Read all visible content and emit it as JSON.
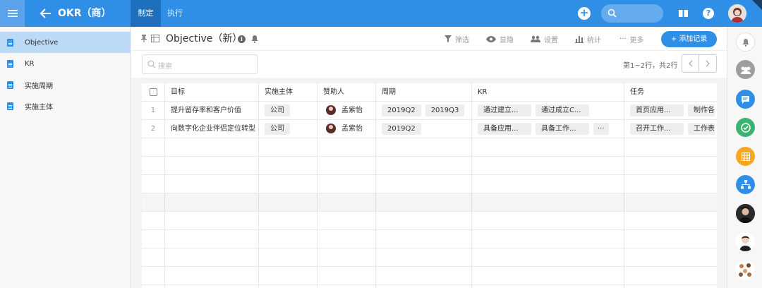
{
  "header": {
    "app_title": "OKR（商）",
    "tabs": [
      {
        "label": "制定"
      },
      {
        "label": "执行"
      }
    ]
  },
  "sidebar": {
    "items": [
      {
        "label": "Objective"
      },
      {
        "label": "KR"
      },
      {
        "label": "实施周期"
      },
      {
        "label": "实施主体"
      }
    ]
  },
  "toolbar": {
    "view_title": "Objective（新）",
    "filter": "筛选",
    "show_hide": "显隐",
    "settings": "设置",
    "stats": "统计",
    "more": "更多",
    "add_record": "+ 添加记录"
  },
  "search": {
    "placeholder": "搜索"
  },
  "pagination": {
    "info": "第1~2行，共2行"
  },
  "table": {
    "columns": [
      "目标",
      "实施主体",
      "赞助人",
      "周期",
      "KR",
      "任务"
    ],
    "rows": [
      {
        "num": "1",
        "goal": "提升留存率和客户价值",
        "entity": "公司",
        "sponsor": "孟紫怡",
        "periods": [
          "2019Q2",
          "2019Q3"
        ],
        "kr": [
          "通过建立...",
          "通过成立C..."
        ],
        "tasks": [
          "首页应用...",
          "制作各"
        ]
      },
      {
        "num": "2",
        "goal": "向数字化企业伴侣定位转型",
        "entity": "公司",
        "sponsor": "孟紫怡",
        "periods": [
          "2019Q2"
        ],
        "kr": [
          "具备应用...",
          "具备工作...",
          "···"
        ],
        "tasks": [
          "召开工作...",
          "工作表"
        ]
      }
    ]
  },
  "colors": {
    "brand": "#2f8fe6",
    "active_tab": "#1f6fbf",
    "sidebar_active": "#bcd9f6"
  }
}
